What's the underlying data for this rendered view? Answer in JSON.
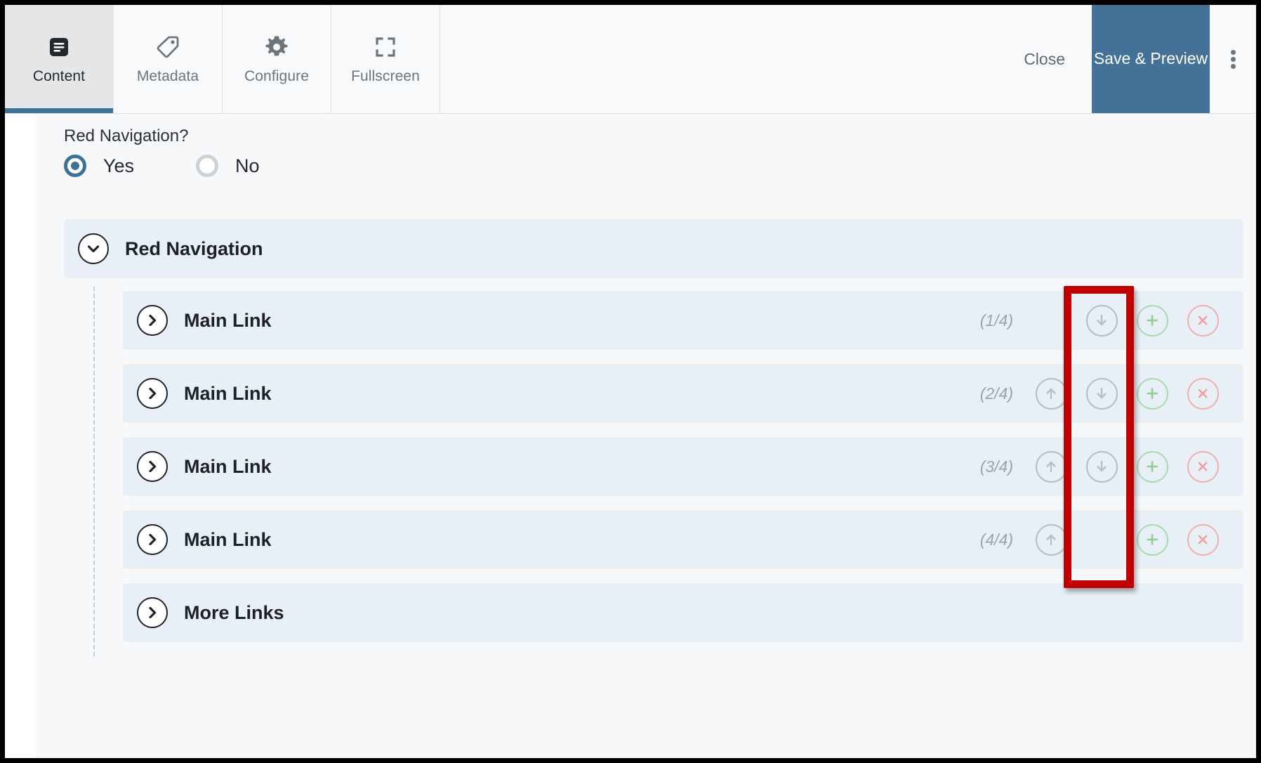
{
  "toolbar": {
    "tabs": [
      {
        "label": "Content",
        "icon": "document-lines-icon",
        "active": true
      },
      {
        "label": "Metadata",
        "icon": "tag-icon",
        "active": false
      },
      {
        "label": "Configure",
        "icon": "gear-icon",
        "active": false
      },
      {
        "label": "Fullscreen",
        "icon": "expand-icon",
        "active": false
      }
    ],
    "close_label": "Close",
    "save_label": "Save & Preview",
    "menu_icon": "kebab-menu-icon",
    "accent_color": "#447198"
  },
  "form": {
    "question_label": "Red Navigation?",
    "options": [
      {
        "label": "Yes",
        "checked": true
      },
      {
        "label": "No",
        "checked": false
      }
    ]
  },
  "group": {
    "title": "Red Navigation",
    "toggle_icon": "chevron-down-icon",
    "rows": [
      {
        "title": "Main Link",
        "icon": "chevron-right-icon",
        "counter": "(1/4)",
        "has_up": false,
        "has_down": true,
        "has_add": true,
        "has_remove": true
      },
      {
        "title": "Main Link",
        "icon": "chevron-right-icon",
        "counter": "(2/4)",
        "has_up": true,
        "has_down": true,
        "has_add": true,
        "has_remove": true
      },
      {
        "title": "Main Link",
        "icon": "chevron-right-icon",
        "counter": "(3/4)",
        "has_up": true,
        "has_down": true,
        "has_add": true,
        "has_remove": true
      },
      {
        "title": "Main Link",
        "icon": "chevron-right-icon",
        "counter": "(4/4)",
        "has_up": true,
        "has_down": false,
        "has_add": true,
        "has_remove": true
      },
      {
        "title": "More Links",
        "icon": "chevron-right-icon",
        "counter": "",
        "has_up": false,
        "has_down": false,
        "has_add": false,
        "has_remove": false
      }
    ]
  },
  "annotation": {
    "highlight_color": "#c00000",
    "target": "add-item-button-column"
  }
}
